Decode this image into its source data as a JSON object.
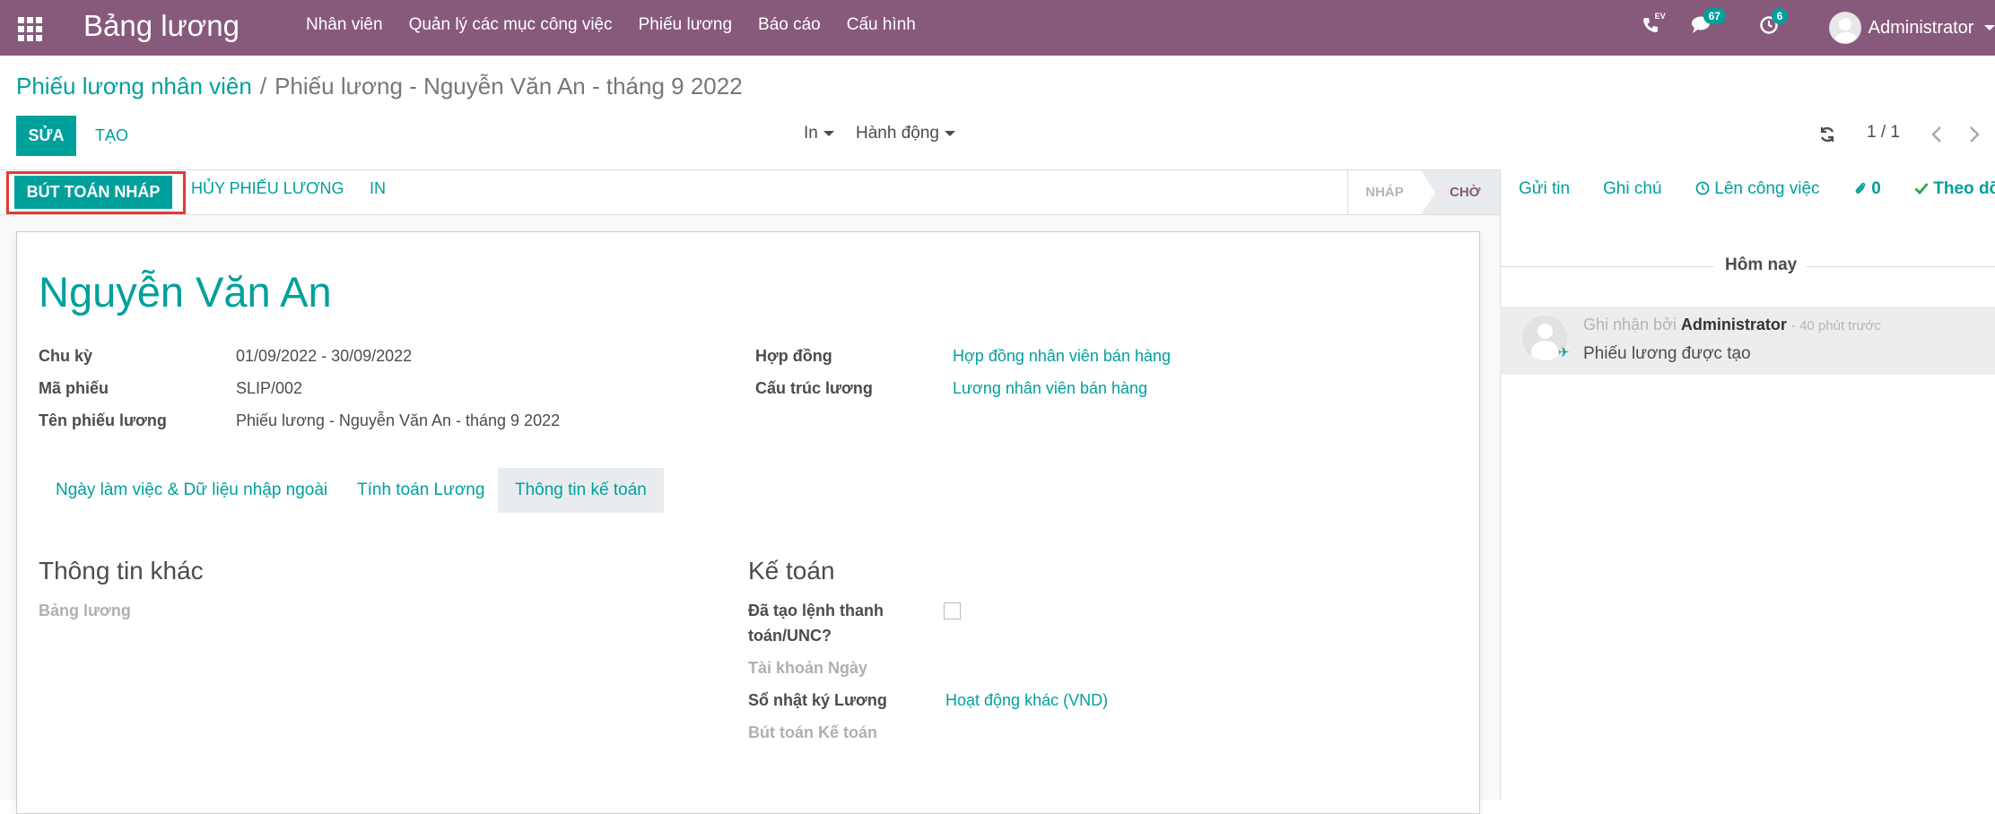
{
  "navbar": {
    "app_title": "Bảng lương",
    "menu": [
      "Nhân viên",
      "Quản lý các mục công việc",
      "Phiếu lương",
      "Báo cáo",
      "Cấu hình"
    ],
    "phone_label": "EV",
    "messages_count": "67",
    "activities_count": "6",
    "user": "Administrator"
  },
  "breadcrumb": {
    "parent": "Phiếu lương nhân viên",
    "separator": "/",
    "current": "Phiếu lương - Nguyễn Văn An - tháng 9 2022"
  },
  "controls": {
    "edit": "SỬA",
    "create": "TẠO",
    "print": "In",
    "action": "Hành động",
    "pager": "1 / 1"
  },
  "statusbar": {
    "post_entry": "BÚT TOÁN NHÁP",
    "cancel": "HỦY PHIẾU LƯƠNG",
    "print": "IN",
    "stages": [
      "NHÁP",
      "CHỜ"
    ]
  },
  "form": {
    "employee": "Nguyễn Văn An",
    "period_label": "Chu kỳ",
    "period_value": "01/09/2022 - 30/09/2022",
    "ref_label": "Mã phiếu",
    "ref_value": "SLIP/002",
    "name_label": "Tên phiếu lương",
    "name_value": "Phiếu lương - Nguyễn Văn An - tháng 9 2022",
    "contract_label": "Hợp đồng",
    "contract_value": "Hợp đồng nhân viên bán hàng",
    "struct_label": "Cấu trúc lương",
    "struct_value": "Lương nhân viên bán hàng",
    "tabs": [
      "Ngày làm việc & Dữ liệu nhập ngoài",
      "Tính toán Lương",
      "Thông tin kế toán"
    ],
    "other_info_title": "Thông tin khác",
    "payslip_batch_label": "Bảng lương",
    "accounting_title": "Kế toán",
    "payment_line1": "Đã tạo lệnh thanh",
    "payment_line2": "toán/UNC?",
    "date_account_label": "Tài khoản Ngày",
    "journal_label": "Sổ nhật ký Lương",
    "journal_value": "Hoạt động khác (VND)",
    "move_label": "Bút toán Kế toán"
  },
  "chatter": {
    "send_message": "Gửi tin",
    "log_note": "Ghi chú",
    "schedule_activity": "Lên công việc",
    "attachments": "0",
    "follow": "Theo dõ",
    "today": "Hôm nay",
    "message": {
      "prefix": "Ghi nhận bởi",
      "author": "Administrator",
      "time": "- 40 phút trước",
      "body": "Phiếu lương được tạo"
    }
  }
}
